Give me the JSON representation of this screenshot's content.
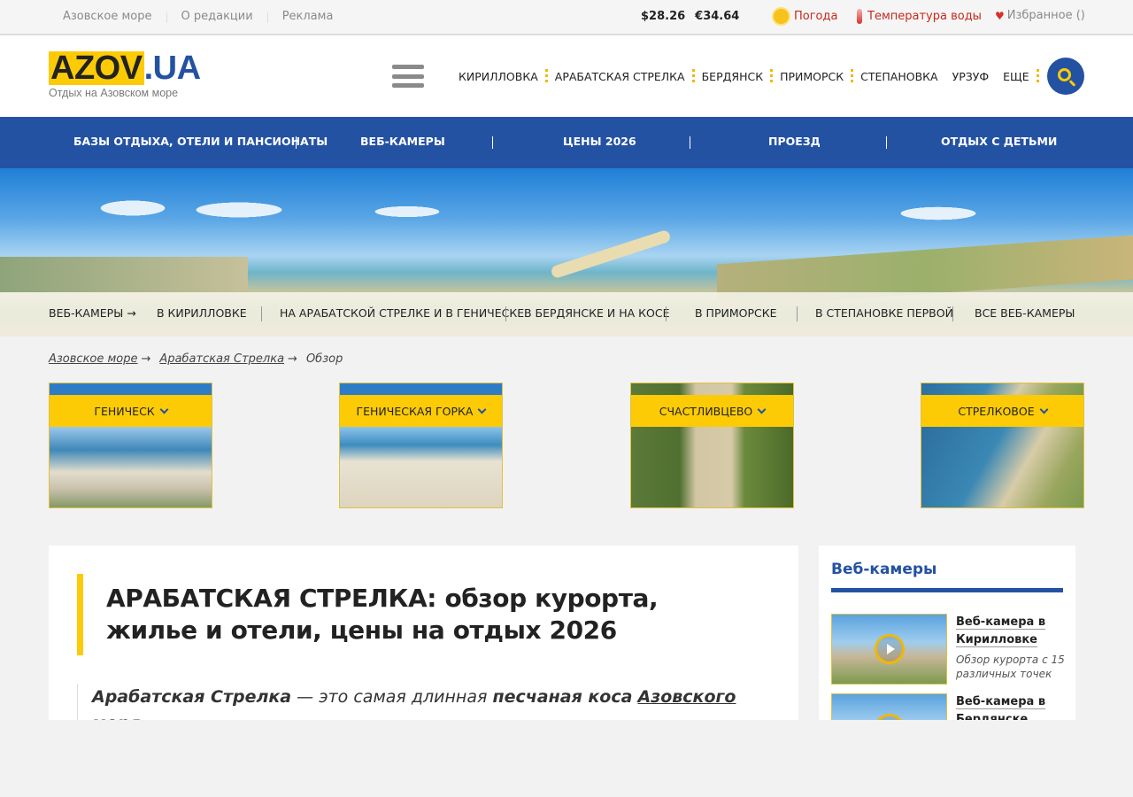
{
  "topbar": {
    "links": [
      "Азовское море",
      "О редакции",
      "Реклама"
    ],
    "usd": "$28.26",
    "eur": "€34.64",
    "weather": "Погода",
    "water_temp": "Температура воды",
    "favorites": "Избранное ()"
  },
  "logo": {
    "part1": "AZOV",
    "part2": ".UA",
    "tagline": "Отдых на Азовском море"
  },
  "city_nav": [
    "КИРИЛЛОВКА",
    "АРАБАТСКАЯ СТРЕЛКА",
    "БЕРДЯНСК",
    "ПРИМОРСК",
    "СТЕПАНОВКА",
    "УРЗУФ",
    "ЕЩЕ"
  ],
  "main_nav": [
    "БАЗЫ ОТДЫХА, ОТЕЛИ И ПАНСИОНАТЫ",
    "ВЕБ-КАМЕРЫ",
    "ЦЕНЫ 2026",
    "ПРОЕЗД",
    "ОТДЫХ С ДЕТЬМИ"
  ],
  "webcam_bar": {
    "label": "ВЕБ-КАМЕРЫ →",
    "items": [
      "В КИРИЛЛОВКЕ",
      "НА АРАБАТСКОЙ СТРЕЛКЕ И В ГЕНИЧЕСКЕ",
      "В БЕРДЯНСКЕ И НА КОСЕ",
      "В ПРИМОРСКЕ",
      "В СТЕПАНОВКЕ ПЕРВОЙ",
      "ВСЕ ВЕБ-КАМЕРЫ"
    ]
  },
  "breadcrumbs": [
    "Азовское море",
    "Арабатская Стрелка",
    "Обзор"
  ],
  "tiles": [
    "ГЕНИЧЕСК",
    "ГЕНИЧЕСКАЯ ГОРКА",
    "СЧАСТЛИВЦЕВО",
    "СТРЕЛКОВОЕ"
  ],
  "article": {
    "title": "АРАБАТСКАЯ СТРЕЛКА: обзор курорта, жилье и отели, цены на отдых 2026",
    "lead_bold1": "Арабатская Стрелка",
    "lead_text1": " — это самая длинная ",
    "lead_bold2": "песчаная коса",
    "lead_text2": " ",
    "lead_link": "Азовского моря",
    "lead_text3": ","
  },
  "sidebar": {
    "title": "Веб-камеры",
    "cams": [
      {
        "title": "Веб-камера в Кирилловке",
        "subtitle": "Обзор курорта с 15 различных точек"
      },
      {
        "title": "Веб-камера в Бердянске",
        "subtitle": ""
      }
    ]
  },
  "colors": {
    "brand_blue": "#2452a2",
    "brand_yellow": "#fccb05",
    "alert_red": "#c8281e"
  }
}
